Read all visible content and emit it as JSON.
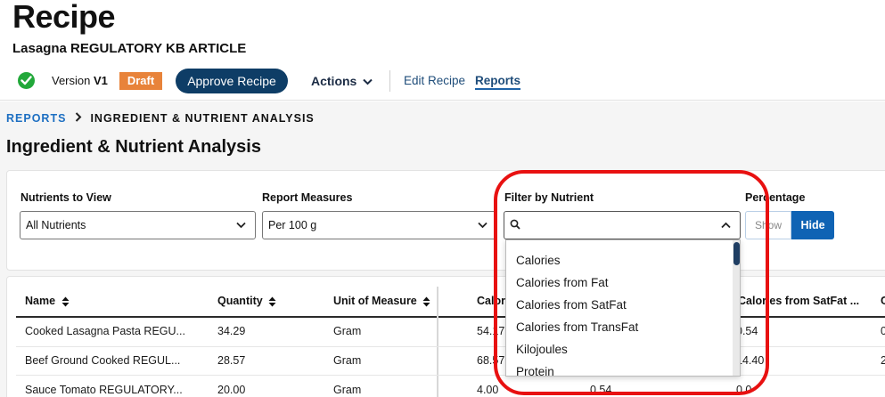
{
  "header": {
    "title": "Recipe",
    "subtitle": "Lasagna REGULATORY KB ARTICLE",
    "version_label": "Version",
    "version_value": "V1",
    "status_badge": "Draft",
    "approve_button": "Approve Recipe",
    "actions_label": "Actions",
    "tabs": [
      {
        "label": "Edit Recipe",
        "active": false
      },
      {
        "label": "Reports",
        "active": true
      }
    ]
  },
  "breadcrumb": {
    "parent": "REPORTS",
    "current": "INGREDIENT & NUTRIENT ANALYSIS"
  },
  "section_title": "Ingredient & Nutrient Analysis",
  "filters": {
    "nutrients_label": "Nutrients to View",
    "nutrients_value": "All Nutrients",
    "measures_label": "Report Measures",
    "measures_value": "Per 100 g",
    "filter_label": "Filter by Nutrient",
    "filter_value": "",
    "percentage_label": "Percentage",
    "percentage_show": "Show",
    "percentage_hide": "Hide",
    "percentage_selected": "Hide"
  },
  "nutrient_dropdown": {
    "options": [
      "Calories",
      "Calories from Fat",
      "Calories from SatFat",
      "Calories from TransFat",
      "Kilojoules",
      "Protein"
    ]
  },
  "table": {
    "columns": [
      "Name",
      "Quantity",
      "Unit of Measure",
      "Calor",
      "Calories from SatFat ...",
      "C"
    ],
    "rows": [
      {
        "name": "Cooked Lasagna Pasta REGU...",
        "quantity": "34.29",
        "unit": "Gram",
        "calories": "54.17",
        "satfat": "0.54",
        "extra": "0"
      },
      {
        "name": "Beef Ground Cooked REGUL...",
        "quantity": "28.57",
        "unit": "Gram",
        "calories": "68.57",
        "satfat": "14.40",
        "extra": "2"
      },
      {
        "name": "Sauce Tomato REGULATORY...",
        "quantity": "20.00",
        "unit": "Gram",
        "calories": "4.00",
        "mid": "0.54",
        "satfat": "0.0",
        "extra": ""
      }
    ]
  },
  "colors": {
    "primary": "#0e3d66",
    "accent_blue": "#0f63b4",
    "draft": "#e8833a",
    "success": "#22a83a",
    "highlight": "#e81111"
  }
}
